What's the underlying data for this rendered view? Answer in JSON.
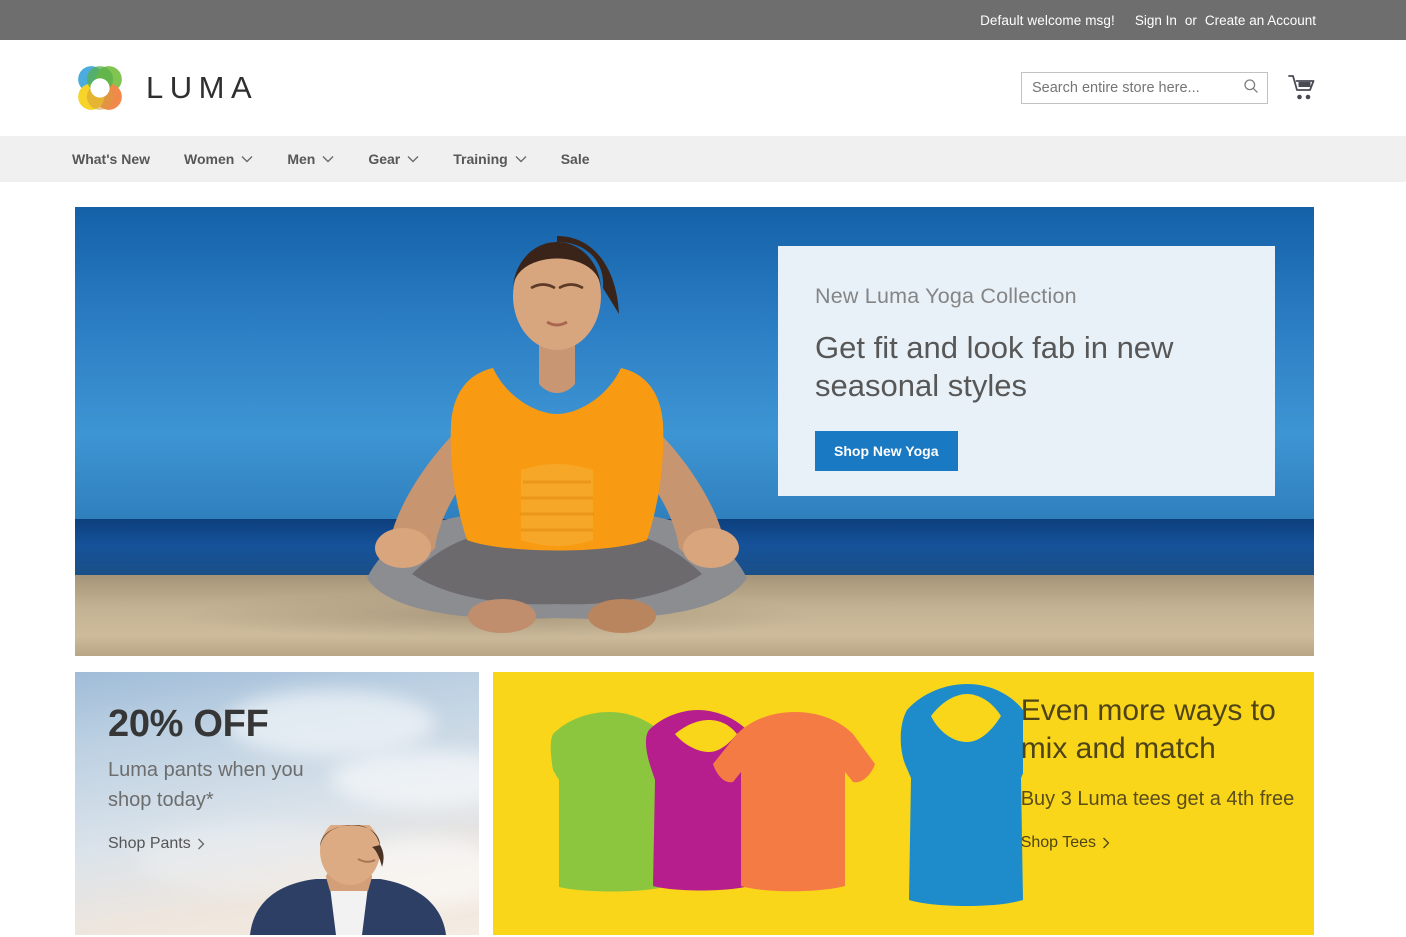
{
  "topbar": {
    "welcome": "Default welcome msg!",
    "sign_in": "Sign In",
    "or": "or",
    "create_account": "Create an Account"
  },
  "header": {
    "logo_text": "LUMA",
    "logo_icon": "luma-ring-logo",
    "search": {
      "placeholder": "Search entire store here...",
      "value": "",
      "icon": "search-icon"
    },
    "cart_icon": "shopping-cart-icon"
  },
  "nav": {
    "items": [
      {
        "label": "What's New",
        "has_caret": false
      },
      {
        "label": "Women",
        "has_caret": true
      },
      {
        "label": "Men",
        "has_caret": true
      },
      {
        "label": "Gear",
        "has_caret": true
      },
      {
        "label": "Training",
        "has_caret": true
      },
      {
        "label": "Sale",
        "has_caret": false
      }
    ]
  },
  "hero": {
    "image_alt": "woman-meditating-on-beach",
    "eyebrow": "New Luma Yoga Collection",
    "title": "Get fit and look fab in new seasonal styles",
    "button_label": "Shop New Yoga"
  },
  "promos": [
    {
      "id": "pants",
      "headline": "20% OFF",
      "subtext": "Luma pants when you shop today*",
      "link_label": "Shop Pants",
      "link_icon": "chevron-right-icon",
      "image_alt": "man-in-navy-hoodie-against-sky"
    },
    {
      "id": "tees",
      "headline": "Even more ways to mix and match",
      "subtext": "Buy 3 Luma tees get a 4th free",
      "link_label": "Shop Tees",
      "link_icon": "chevron-right-icon",
      "image_alt": "four-colored-shirt-silhouettes"
    }
  ],
  "colors": {
    "topbar_bg": "#6e6e6e",
    "nav_bg": "#f0f0f0",
    "accent_blue": "#1979c3",
    "panel_bg": "#e9f1f8",
    "promo_yellow": "#fad61a",
    "shirt_green": "#8cc63f",
    "shirt_magenta": "#b51e8c",
    "shirt_orange": "#f47b44",
    "shirt_blue": "#1e8ccb"
  }
}
